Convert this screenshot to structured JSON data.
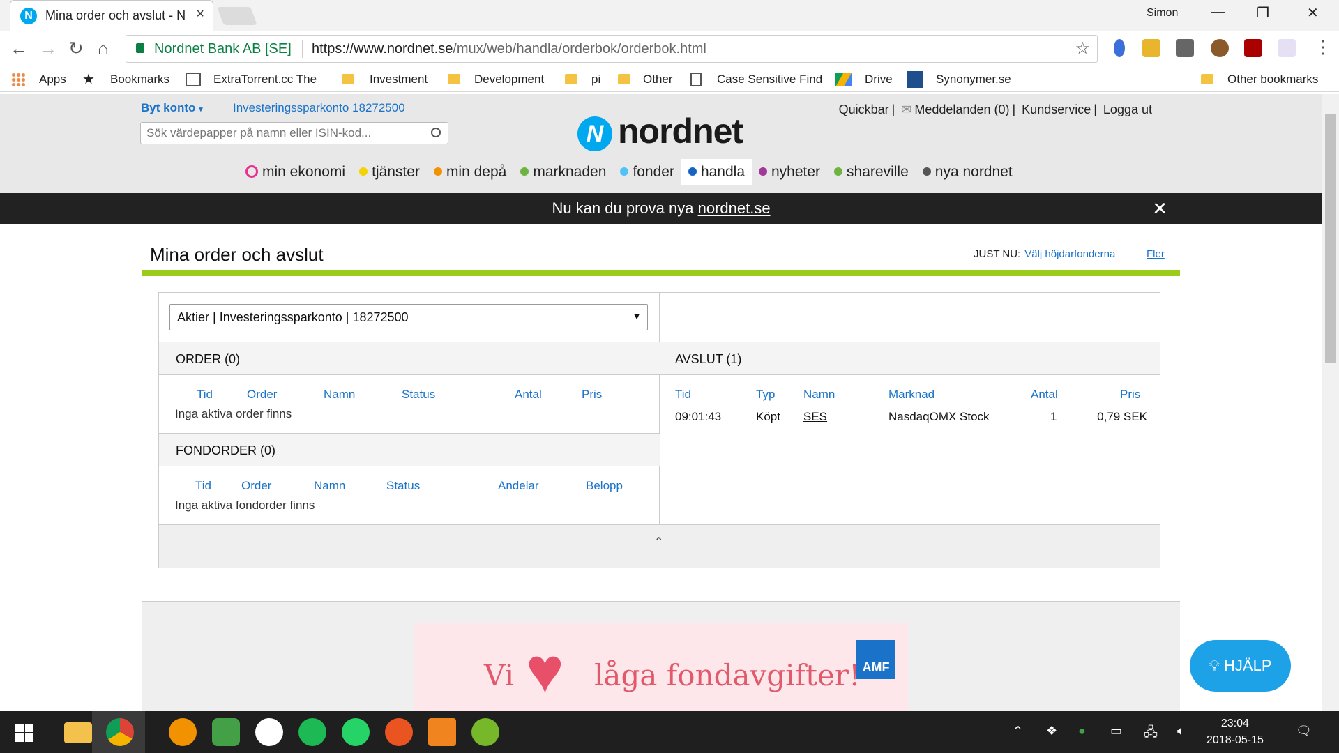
{
  "browser": {
    "tab_title": "Mina order och avslut - N",
    "user": "Simon",
    "site_identity": "Nordnet Bank AB [SE]",
    "url_host": "https://www.nordnet.se",
    "url_path": "/mux/web/handla/orderbok/orderbok.html"
  },
  "bookmarks": [
    "Apps",
    "Bookmarks",
    "ExtraTorrent.cc The V",
    "Investment",
    "Development",
    "pi",
    "Other",
    "Case Sensitive Find",
    "Drive",
    "Synonymer.se",
    "Other bookmarks"
  ],
  "header": {
    "switch_account": "Byt konto",
    "account": "Investeringssparkonto 18272500",
    "search_placeholder": "Sök värdepapper på namn eller ISIN-kod...",
    "logo_text": "nordnet",
    "links": [
      "Quickbar",
      "Meddelanden (0)",
      "Kundservice",
      "Logga ut"
    ]
  },
  "nav": [
    {
      "label": "min ekonomi",
      "color": "#e8318f"
    },
    {
      "label": "tjänster",
      "color": "#f5d300"
    },
    {
      "label": "min depå",
      "color": "#f39200"
    },
    {
      "label": "marknaden",
      "color": "#6cb33f"
    },
    {
      "label": "fonder",
      "color": "#4fc3f7"
    },
    {
      "label": "handla",
      "color": "#1565c0"
    },
    {
      "label": "nyheter",
      "color": "#a4389a"
    },
    {
      "label": "shareville",
      "color": "#6cb33f"
    },
    {
      "label": "nya nordnet",
      "color": "#555555"
    }
  ],
  "banner": {
    "text": "Nu kan du prova nya",
    "link": "nordnet.se"
  },
  "page": {
    "title": "Mina order och avslut",
    "just_nu_label": "JUST NU:",
    "just_nu_link": "Välj höjdarfonderna",
    "more": "Fler"
  },
  "orderbook": {
    "selector": "Aktier | Investeringssparkonto | 18272500",
    "order_title": "ORDER (0)",
    "order_columns": [
      "Tid",
      "Order",
      "Namn",
      "Status",
      "Antal",
      "Pris"
    ],
    "order_empty": "Inga aktiva order finns",
    "fund_title": "FONDORDER (0)",
    "fund_columns": [
      "Tid",
      "Order",
      "Namn",
      "Status",
      "Andelar",
      "Belopp"
    ],
    "fund_empty": "Inga aktiva fondorder finns",
    "trades_title": "AVSLUT (1)",
    "trade_columns": [
      "Tid",
      "Typ",
      "Namn",
      "Marknad",
      "Antal",
      "Pris"
    ],
    "trades": [
      {
        "time": "09:01:43",
        "type": "Köpt",
        "name": "SES",
        "market": "NasdaqOMX Stock",
        "qty": "1",
        "price": "0,79 SEK"
      }
    ]
  },
  "ad": {
    "text_left": "Vi",
    "text_right": "låga fondavgifter!",
    "badge": "AMF"
  },
  "help": "HJÄLP",
  "taskbar": {
    "time": "23:04",
    "date": "2018-05-15"
  }
}
